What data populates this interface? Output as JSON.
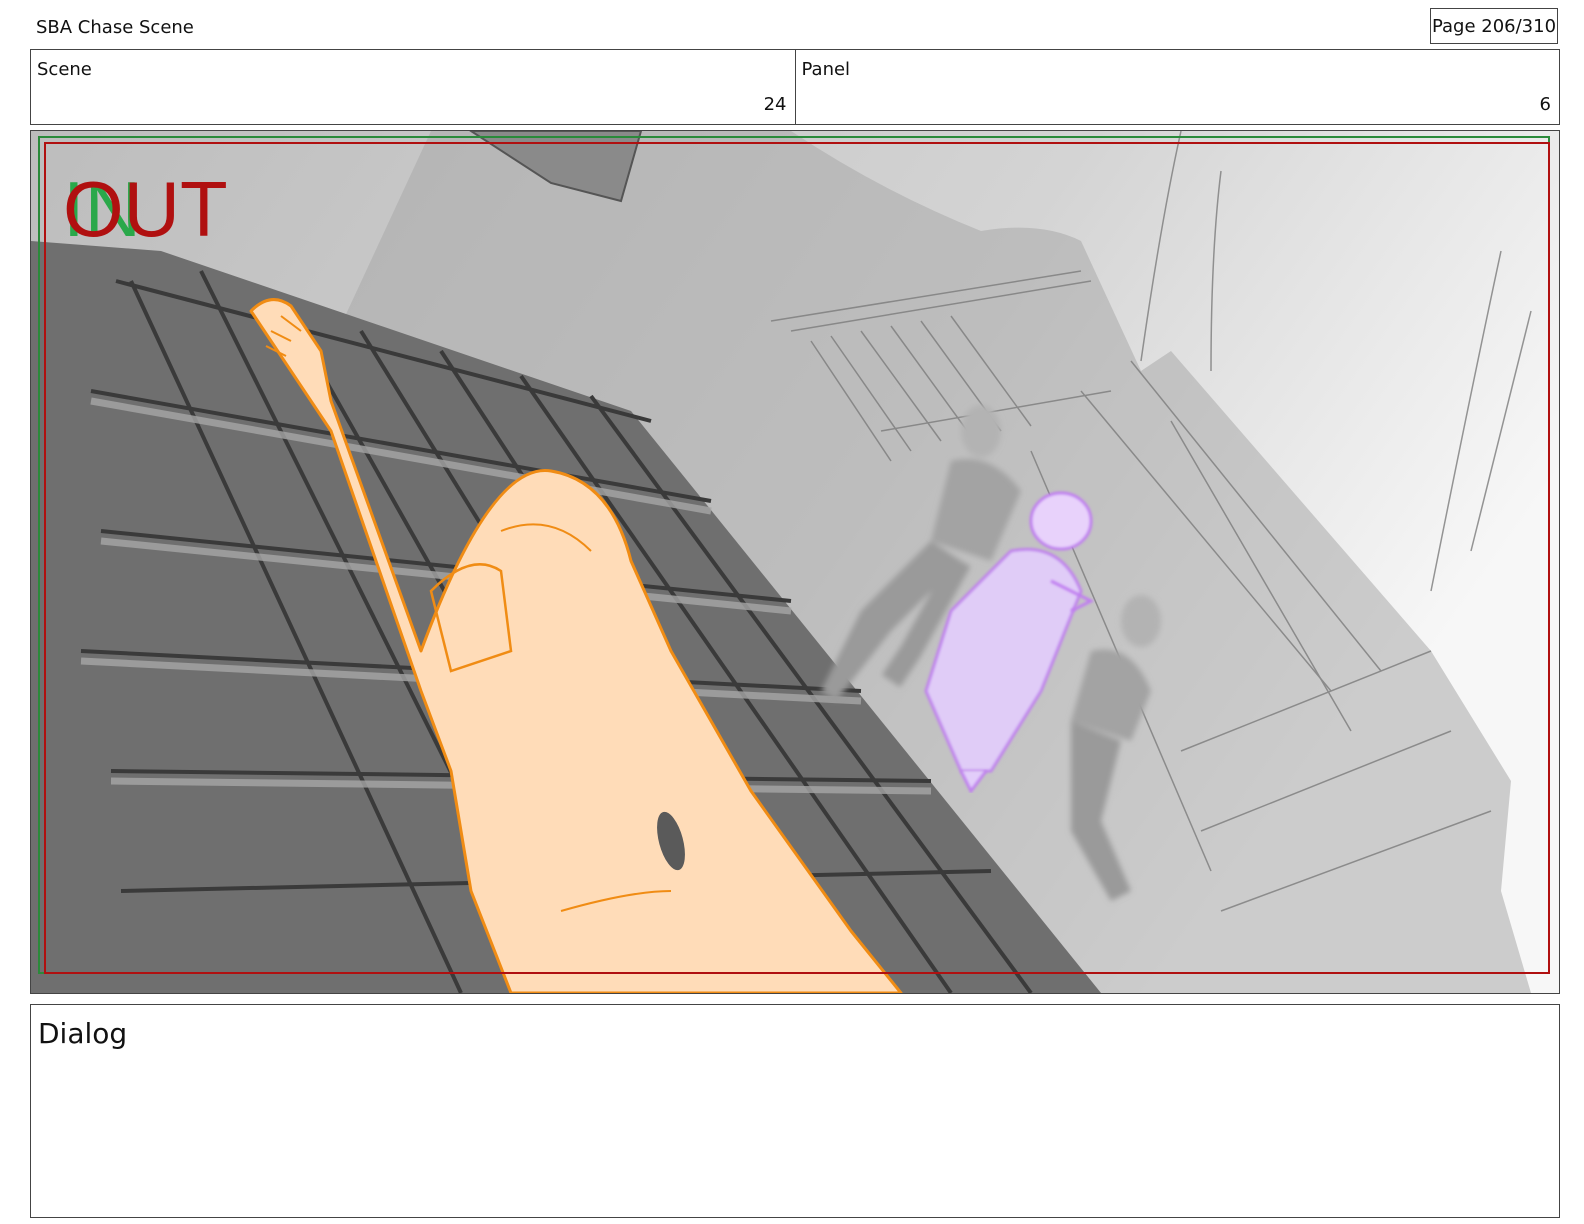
{
  "header": {
    "title": "SBA Chase Scene",
    "page_label": "Page 206/310"
  },
  "info": {
    "scene_label": "Scene",
    "scene_value": "24",
    "panel_label": "Panel",
    "panel_value": "6"
  },
  "panel": {
    "in_marker": "IN",
    "out_marker": "OUT",
    "colors": {
      "in": "#2aa84a",
      "out": "#b01010",
      "foreground_figure": "#ffdcb8",
      "foreground_outline": "#f08c14",
      "highlight_figure": "#c07ef0"
    }
  },
  "dialog": {
    "label": "Dialog"
  }
}
